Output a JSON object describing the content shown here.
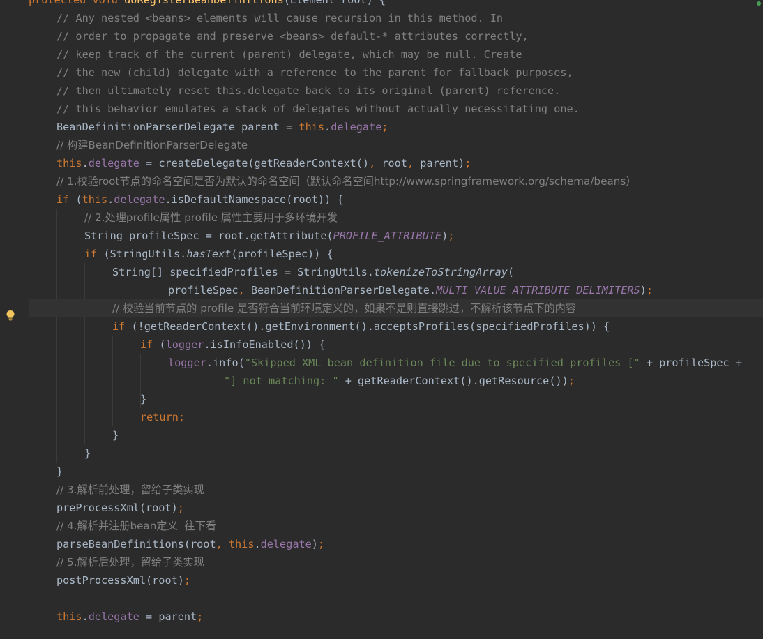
{
  "editor": {
    "lines": [
      [
        [
          "keyword",
          "protected "
        ],
        [
          "keyword",
          "void "
        ],
        [
          "method-decl",
          "doRegisterBeanDefinitions"
        ],
        [
          "plain",
          "(Element root) {"
        ]
      ],
      [
        [
          "comment",
          "// Any nested <beans> elements will cause recursion in this method. In"
        ]
      ],
      [
        [
          "comment",
          "// order to propagate and preserve <beans> default-* attributes correctly,"
        ]
      ],
      [
        [
          "comment",
          "// keep track of the current (parent) delegate, which may be null. Create"
        ]
      ],
      [
        [
          "comment",
          "// the new (child) delegate with a reference to the parent for fallback purposes,"
        ]
      ],
      [
        [
          "comment",
          "// then ultimately reset this.delegate back to its original (parent) reference."
        ]
      ],
      [
        [
          "comment",
          "// this behavior emulates a stack of delegates without actually necessitating one."
        ]
      ],
      [
        [
          "plain",
          "BeanDefinitionParserDelegate parent = "
        ],
        [
          "keyword",
          "this"
        ],
        [
          "plain",
          "."
        ],
        [
          "field",
          "delegate"
        ],
        [
          "punct",
          ";"
        ]
      ],
      [
        [
          "comment",
          "// 构建BeanDefinitionParserDelegate"
        ]
      ],
      [
        [
          "keyword",
          "this"
        ],
        [
          "plain",
          "."
        ],
        [
          "field",
          "delegate"
        ],
        [
          "plain",
          " = createDelegate(getReaderContext()"
        ],
        [
          "punct",
          ", "
        ],
        [
          "plain",
          "root"
        ],
        [
          "punct",
          ", "
        ],
        [
          "plain",
          "parent)"
        ],
        [
          "punct",
          ";"
        ]
      ],
      [
        [
          "comment",
          "// 1.校验root节点的命名空间是否为默认的命名空间（默认命名空间http://www.springframework.org/schema/beans）"
        ]
      ],
      [
        [
          "keyword",
          "if "
        ],
        [
          "plain",
          "("
        ],
        [
          "keyword",
          "this"
        ],
        [
          "plain",
          "."
        ],
        [
          "field",
          "delegate"
        ],
        [
          "plain",
          ".isDefaultNamespace(root)) {"
        ]
      ],
      [
        [
          "comment",
          "// 2.处理profile属性 profile 属性主要用于多环境开发"
        ]
      ],
      [
        [
          "plain",
          "String profileSpec = root.getAttribute("
        ],
        [
          "const",
          "PROFILE_ATTRIBUTE"
        ],
        [
          "plain",
          ")"
        ],
        [
          "punct",
          ";"
        ]
      ],
      [
        [
          "keyword",
          "if "
        ],
        [
          "plain",
          "(StringUtils."
        ],
        [
          "static",
          "hasText"
        ],
        [
          "plain",
          "(profileSpec)) {"
        ]
      ],
      [
        [
          "plain",
          "String[] specifiedProfiles = StringUtils."
        ],
        [
          "static",
          "tokenizeToStringArray"
        ],
        [
          "plain",
          "("
        ]
      ],
      [
        [
          "plain",
          "profileSpec"
        ],
        [
          "punct",
          ", "
        ],
        [
          "plain",
          "BeanDefinitionParserDelegate."
        ],
        [
          "const",
          "MULTI_VALUE_ATTRIBUTE_DELIMITERS"
        ],
        [
          "plain",
          ")"
        ],
        [
          "punct",
          ";"
        ]
      ],
      [
        [
          "comment",
          "// 校验当前节点的 profile 是否符合当前环境定义的，如果不是则直接跳过，不解析该节点下的内容"
        ]
      ],
      [
        [
          "keyword",
          "if "
        ],
        [
          "plain",
          "(!getReaderContext().getEnvironment().acceptsProfiles(specifiedProfiles)) {"
        ]
      ],
      [
        [
          "keyword",
          "if "
        ],
        [
          "plain",
          "("
        ],
        [
          "field",
          "logger"
        ],
        [
          "plain",
          ".isInfoEnabled()) {"
        ]
      ],
      [
        [
          "field",
          "logger"
        ],
        [
          "plain",
          ".info("
        ],
        [
          "string",
          "\"Skipped XML bean definition file due to specified profiles [\" "
        ],
        [
          "plain",
          "+ profileSpec +"
        ]
      ],
      [
        [
          "string",
          "\"] not matching: \" "
        ],
        [
          "plain",
          "+ getReaderContext().getResource())"
        ],
        [
          "punct",
          ";"
        ]
      ],
      [
        [
          "plain",
          "}"
        ]
      ],
      [
        [
          "keyword",
          "return"
        ],
        [
          "punct",
          ";"
        ]
      ],
      [
        [
          "plain",
          "}"
        ]
      ],
      [
        [
          "plain",
          "}"
        ]
      ],
      [
        [
          "plain",
          "}"
        ]
      ],
      [
        [
          "comment",
          "// 3.解析前处理，留给子类实现"
        ]
      ],
      [
        [
          "plain",
          "preProcessXml(root)"
        ],
        [
          "punct",
          ";"
        ]
      ],
      [
        [
          "comment",
          "// 4.解析并注册bean定义  往下看"
        ]
      ],
      [
        [
          "plain",
          "parseBeanDefinitions(root"
        ],
        [
          "punct",
          ", "
        ],
        [
          "keyword",
          "this"
        ],
        [
          "plain",
          "."
        ],
        [
          "field",
          "delegate"
        ],
        [
          "plain",
          ")"
        ],
        [
          "punct",
          ";"
        ]
      ],
      [
        [
          "comment",
          "// 5.解析后处理，留给子类实现"
        ]
      ],
      [
        [
          "plain",
          "postProcessXml(root)"
        ],
        [
          "punct",
          ";"
        ]
      ],
      [],
      [
        [
          "keyword",
          "this"
        ],
        [
          "plain",
          "."
        ],
        [
          "field",
          "delegate"
        ],
        [
          "plain",
          " = parent"
        ],
        [
          "punct",
          ";"
        ]
      ]
    ]
  }
}
